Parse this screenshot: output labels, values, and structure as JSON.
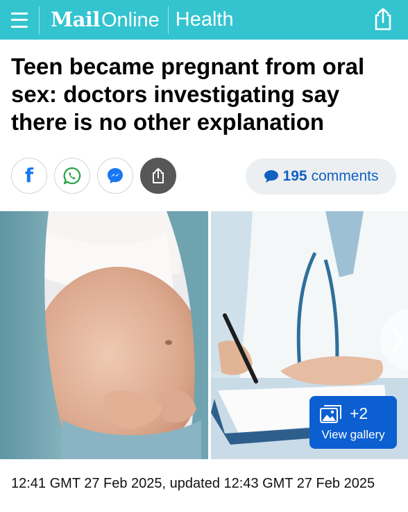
{
  "header": {
    "brand_bold": "Mail",
    "brand_light": "Online",
    "section": "Health",
    "accent_color": "#33c4cf",
    "menu_icon": "hamburger-icon",
    "share_icon": "share-icon"
  },
  "article": {
    "headline": "Teen became pregnant from oral sex: doctors investigating say there is no other explanation",
    "timestamp": "12:41 GMT 27 Feb 2025, updated 12:43 GMT 27 Feb 2025"
  },
  "social": {
    "buttons": [
      {
        "name": "facebook",
        "icon": "facebook-icon"
      },
      {
        "name": "whatsapp",
        "icon": "whatsapp-icon"
      },
      {
        "name": "messenger",
        "icon": "messenger-icon"
      },
      {
        "name": "share",
        "icon": "share-icon"
      }
    ],
    "facebook_glyph": "f",
    "comments_count": "195",
    "comments_label": "comments",
    "comments_color": "#1060c0"
  },
  "gallery": {
    "plus_count": "+2",
    "label": "View gallery",
    "color": "#0b5fd0"
  }
}
